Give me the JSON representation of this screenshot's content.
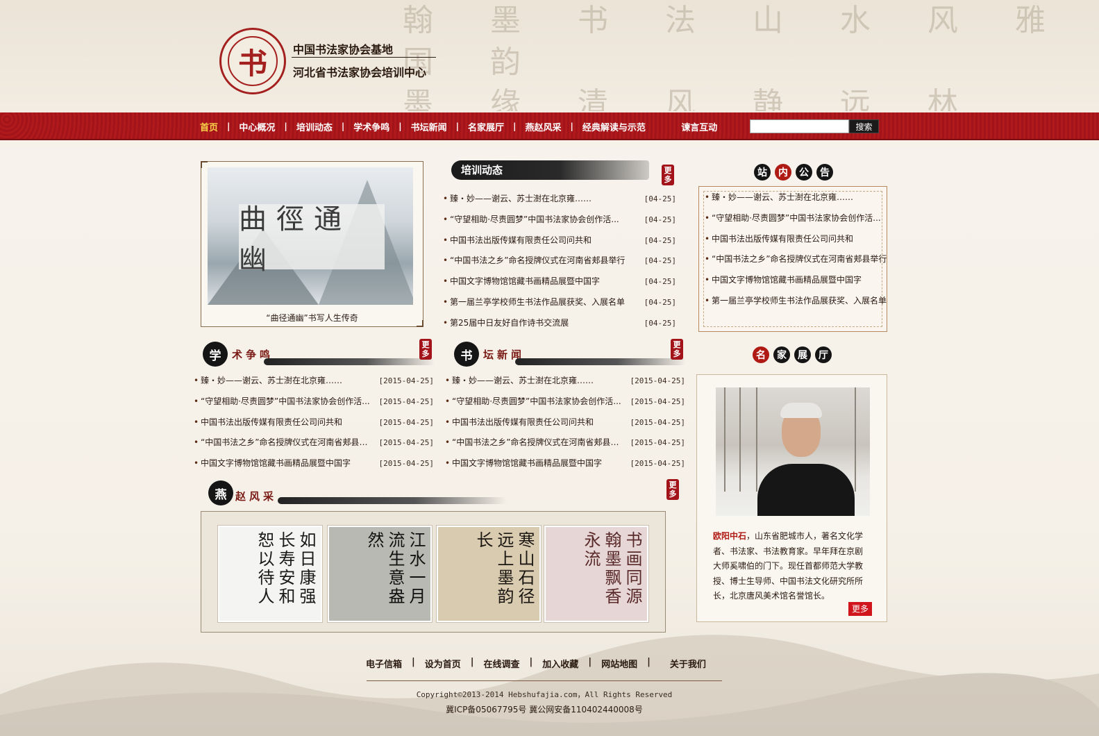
{
  "header": {
    "org_line1": "中国书法家协会基地",
    "org_line2": "河北省书法家协会培训中心",
    "logo_char": "书"
  },
  "nav": {
    "items": [
      "首页",
      "中心概况",
      "培训动态",
      "学术争鸣",
      "书坛新闻",
      "名家展厅",
      "燕赵风采",
      "经典解读与示范",
      "谏言互动"
    ],
    "active_index": 0,
    "search_placeholder": "",
    "search_button": "搜索"
  },
  "feature": {
    "banner_text": "曲徑通幽",
    "caption": "“曲径通幽”书写人生传奇"
  },
  "training": {
    "title": "培训动态",
    "more": "更多",
    "items": [
      {
        "title": "臻・妙——谢云、苏士澍在北京雍……",
        "date": "[04-25]"
      },
      {
        "title": "“守望相助·尽责圆梦”中国书法家协会创作活...",
        "date": "[04-25]"
      },
      {
        "title": "中国书法出版传媒有限责任公司问共和",
        "date": "[04-25]"
      },
      {
        "title": "“中国书法之乡”命名授牌仪式在河南省郏县举行",
        "date": "[04-25]"
      },
      {
        "title": "中国文字博物馆馆藏书画精品展暨中国字",
        "date": "[04-25]"
      },
      {
        "title": "第一届兰亭学校师生书法作品展获奖、入展名单",
        "date": "[04-25]"
      },
      {
        "title": "第25届中日友好自作诗书交流展",
        "date": "[04-25]"
      }
    ]
  },
  "notice": {
    "title_chars": [
      "站",
      "内",
      "公",
      "告"
    ],
    "items": [
      "臻・妙——谢云、苏士澍在北京雍……",
      "“守望相助·尽责圆梦”中国书法家协会创作活...",
      "中国书法出版传媒有限责任公司问共和",
      "“中国书法之乡”命名授牌仪式在河南省郏县举行",
      "中国文字博物馆馆藏书画精品展暨中国字",
      "第一届兰亭学校师生书法作品展获奖、入展名单"
    ]
  },
  "academic": {
    "seal": "学",
    "label": "术争鸣",
    "more": "更多",
    "items": [
      {
        "title": "臻・妙——谢云、苏士澍在北京雍……",
        "date": "[2015-04-25]"
      },
      {
        "title": "“守望相助·尽责圆梦”中国书法家协会创作活...",
        "date": "[2015-04-25]"
      },
      {
        "title": "中国书法出版传媒有限责任公司问共和",
        "date": "[2015-04-25]"
      },
      {
        "title": "“中国书法之乡”命名授牌仪式在河南省郏县举行",
        "date": "[2015-04-25]"
      },
      {
        "title": "中国文字博物馆馆藏书画精品展暨中国字",
        "date": "[2015-04-25]"
      }
    ]
  },
  "news": {
    "seal": "书",
    "label": "坛新闻",
    "more": "更多",
    "items": [
      {
        "title": "臻・妙——谢云、苏士澍在北京雍……",
        "date": "[2015-04-25]"
      },
      {
        "title": "“守望相助·尽责圆梦”中国书法家协会创作活...",
        "date": "[2015-04-25]"
      },
      {
        "title": "中国书法出版传媒有限责任公司问共和",
        "date": "[2015-04-25]"
      },
      {
        "title": "“中国书法之乡”命名授牌仪式在河南省郏县举行",
        "date": "[2015-04-25]"
      },
      {
        "title": "中国文字博物馆馆藏书画精品展暨中国字",
        "date": "[2015-04-25]"
      }
    ]
  },
  "yanzhao": {
    "seal": "燕",
    "label": "赵风采",
    "more": "更多",
    "pieces": [
      {
        "text": "如日康强长寿安和恕以待人",
        "bg": "#f4f4f2",
        "fg": "#1a1a1a"
      },
      {
        "text": "江水一月流生意盎然",
        "bg": "#b9b9b3",
        "fg": "#111111"
      },
      {
        "text": "寒山石径远上墨韵长",
        "bg": "#d9cbb0",
        "fg": "#1a1612"
      },
      {
        "text": "书画同源翰墨飘香永流",
        "bg": "#e6d6d6",
        "fg": "#5a2a2a"
      }
    ]
  },
  "masters": {
    "title_chars": [
      "名",
      "家",
      "展",
      "厅"
    ],
    "name": "欧阳中石",
    "bio": "，山东省肥城市人，著名文化学者、书法家、书法教育家。早年拜在京剧大师奚啸伯的门下。现任首都师范大学教授、博士生导师、中国书法文化研究所所长，北京唐风美术馆名誉馆长。",
    "more": "更多"
  },
  "footer": {
    "links": [
      "电子信箱",
      "设为首页",
      "在线调查",
      "加入收藏",
      "网站地图",
      "关于我们"
    ],
    "copyright": "Copyright©2013-2014 Hebshufajia.com，All Rights Reserved",
    "icp": "冀ICP备05067795号 冀公网安备110402440008号"
  },
  "colors": {
    "nav_red": "#a51619",
    "active_gold": "#f9d44a",
    "seal_red": "#b01a14"
  }
}
